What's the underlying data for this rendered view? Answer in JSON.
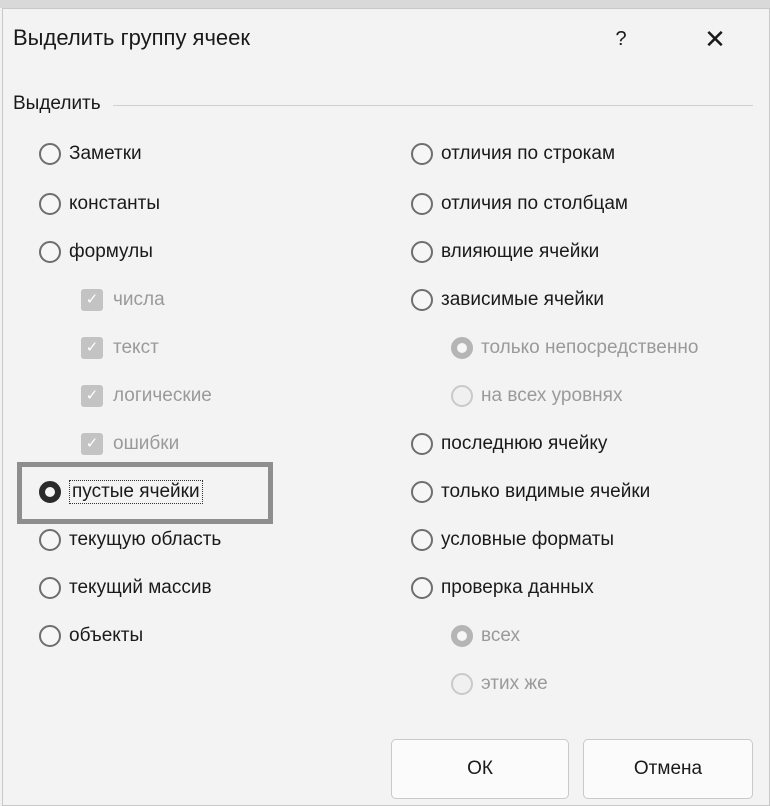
{
  "dialog": {
    "title": "Выделить группу ячеек",
    "help_label": "?",
    "close_label": "✕",
    "group_label": "Выделить"
  },
  "left_options": [
    {
      "label": "Заметки",
      "selected": false
    },
    {
      "label": "константы",
      "selected": false
    },
    {
      "label": "формулы",
      "selected": false
    },
    {
      "label": "пустые ячейки",
      "selected": true
    },
    {
      "label": "текущую область",
      "selected": false
    },
    {
      "label": "текущий массив",
      "selected": false
    },
    {
      "label": "объекты",
      "selected": false
    }
  ],
  "formula_subtypes": [
    {
      "label": "числа",
      "checked": true,
      "disabled": true
    },
    {
      "label": "текст",
      "checked": true,
      "disabled": true
    },
    {
      "label": "логические",
      "checked": true,
      "disabled": true
    },
    {
      "label": "ошибки",
      "checked": true,
      "disabled": true
    }
  ],
  "right_options": [
    {
      "label": "отличия по строкам",
      "selected": false
    },
    {
      "label": "отличия по столбцам",
      "selected": false
    },
    {
      "label": "влияющие ячейки",
      "selected": false
    },
    {
      "label": "зависимые ячейки",
      "selected": false
    },
    {
      "label": "последнюю ячейку",
      "selected": false
    },
    {
      "label": "только видимые ячейки",
      "selected": false
    },
    {
      "label": "условные форматы",
      "selected": false
    },
    {
      "label": "проверка данных",
      "selected": false
    }
  ],
  "dependents_sub": [
    {
      "label": "только непосредственно",
      "selected": true,
      "disabled": true
    },
    {
      "label": "на всех уровнях",
      "selected": false,
      "disabled": true
    }
  ],
  "validation_sub": [
    {
      "label": "всех",
      "selected": true,
      "disabled": true
    },
    {
      "label": "этих же",
      "selected": false,
      "disabled": true
    }
  ],
  "buttons": {
    "ok": "ОК",
    "cancel": "Отмена"
  },
  "icons": {
    "check": "check-icon",
    "help": "help-icon",
    "close": "close-icon"
  }
}
